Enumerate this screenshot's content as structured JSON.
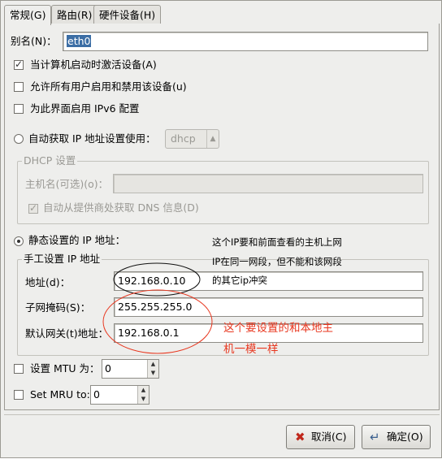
{
  "tabs": [
    {
      "label": "常规(G)"
    },
    {
      "label": "路由(R)"
    },
    {
      "label": "硬件设备(H)"
    }
  ],
  "general": {
    "nickname_label": "别名(N)：",
    "nickname_value": "eth0",
    "activate_on_boot_label": "当计算机启动时激活设备(A)",
    "activate_on_boot_checked": true,
    "allow_all_users_label": "允许所有用户启用和禁用该设备(u)",
    "allow_all_users_checked": false,
    "enable_ipv6_label": "为此界面启用 IPv6 配置",
    "enable_ipv6_checked": false
  },
  "auto_ip": {
    "label": "自动获取 IP 地址设置使用：",
    "selected": false,
    "method_value": "dhcp",
    "dhcp_frame_title": "DHCP 设置",
    "hostname_label": "主机名(可选)(o)：",
    "hostname_value": "",
    "auto_dns_label": "自动从提供商处获取 DNS 信息(D)",
    "auto_dns_checked": true
  },
  "static_ip": {
    "label": "静态设置的 IP 地址：",
    "selected": true,
    "frame_title": "手工设置 IP 地址",
    "address_label": "地址(d)：",
    "address_value": "192.168.0.10",
    "netmask_label": "子网掩码(S)：",
    "netmask_value": "255.255.255.0",
    "gateway_label": "默认网关(t)地址：",
    "gateway_value": "192.168.0.1"
  },
  "mtu": {
    "label": "设置 MTU 为：",
    "checked": false,
    "value": "0"
  },
  "mru": {
    "label": "Set MRU to:",
    "checked": false,
    "value": "0"
  },
  "buttons": {
    "cancel_label": "取消(C)",
    "ok_label": "确定(O)"
  },
  "annotations": {
    "note_black_line1": "这个IP要和前面查看的主机上网",
    "note_black_line2": "IP在同一网段，但不能和该网段",
    "note_black_line3": "的其它ip冲突",
    "note_red_line1": "这个要设置的和本地主",
    "note_red_line2": "机一模一样",
    "red_color": "#e8371f"
  }
}
